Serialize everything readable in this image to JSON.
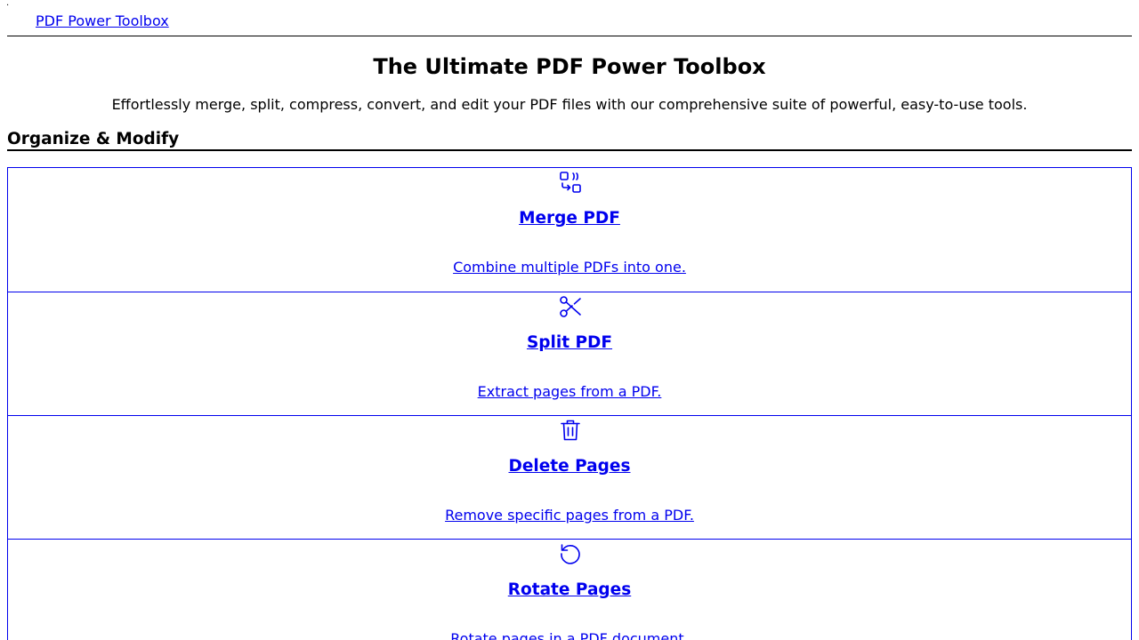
{
  "header": {
    "marker": "·",
    "brand": "PDF Power Toolbox"
  },
  "hero": {
    "title": "The Ultimate PDF Power Toolbox",
    "subtitle": "Effortlessly merge, split, compress, convert, and edit your PDF files with our comprehensive suite of powerful, easy-to-use tools."
  },
  "section": {
    "title": "Organize & Modify",
    "tools": [
      {
        "icon": "merge-icon",
        "name": "Merge PDF",
        "description": "Combine multiple PDFs into one."
      },
      {
        "icon": "scissors-icon",
        "name": "Split PDF",
        "description": "Extract pages from a PDF."
      },
      {
        "icon": "trash-icon",
        "name": "Delete Pages",
        "description": "Remove specific pages from a PDF."
      },
      {
        "icon": "rotate-icon",
        "name": "Rotate Pages",
        "description": "Rotate pages in a PDF document."
      }
    ]
  },
  "colors": {
    "link": "#0000ee",
    "text": "#000000",
    "background": "#ffffff"
  }
}
